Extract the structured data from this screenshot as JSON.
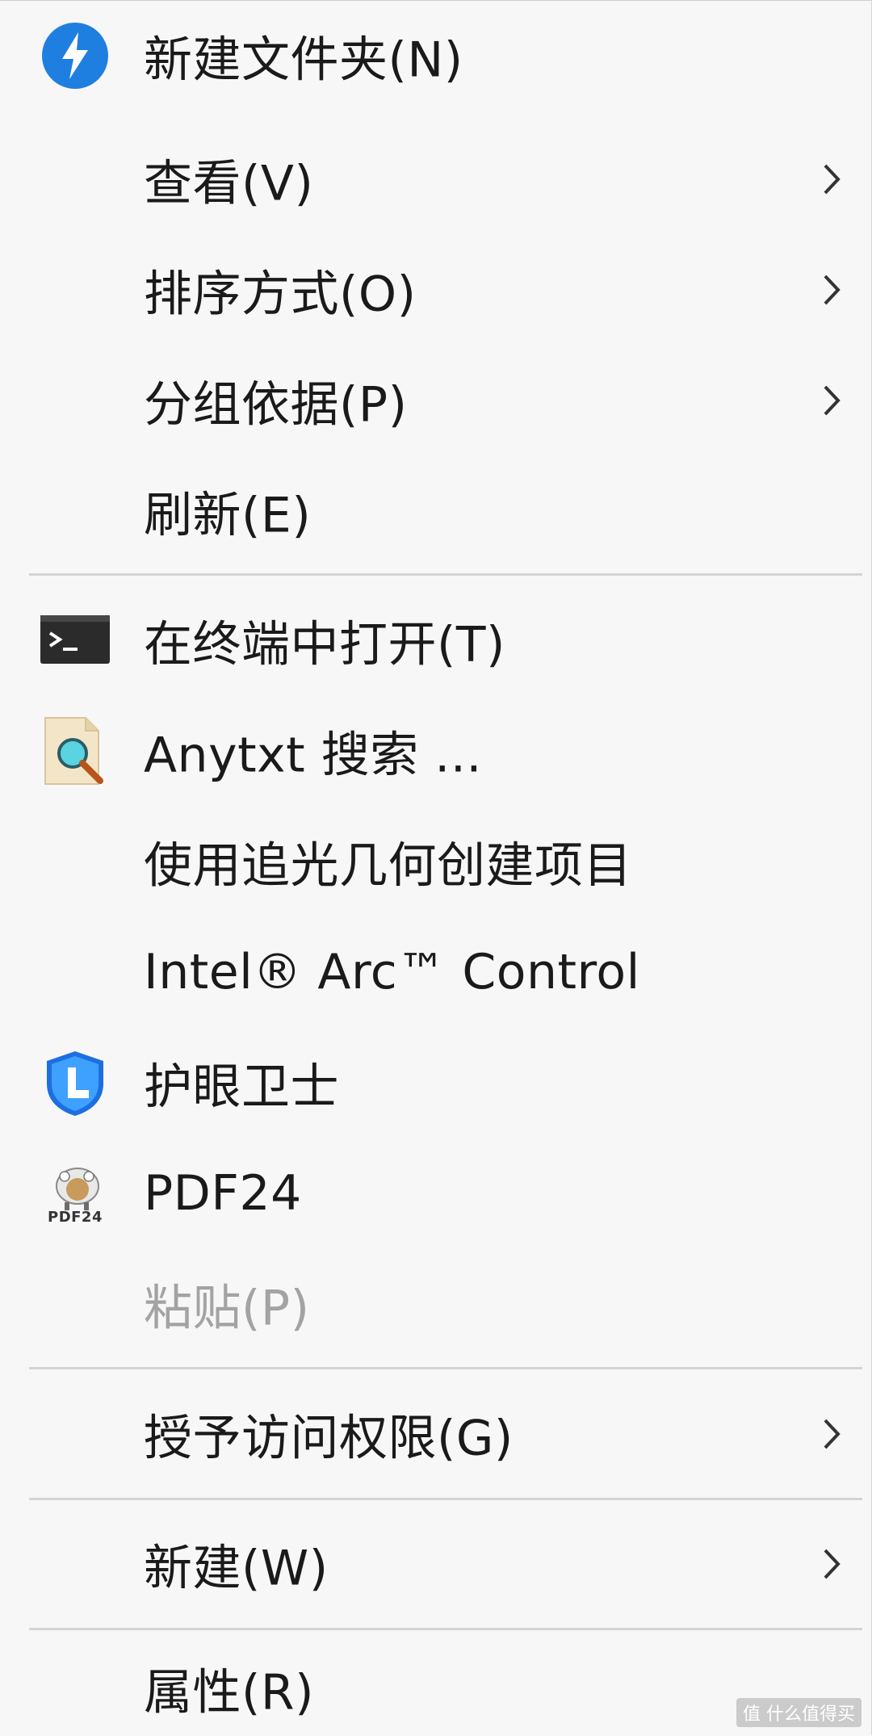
{
  "menu": {
    "items": [
      {
        "label": "新建文件夹(N)",
        "icon": "lightning-circle-icon",
        "submenu": false,
        "disabled": false
      },
      {
        "label": "查看(V)",
        "icon": null,
        "submenu": true,
        "disabled": false
      },
      {
        "label": "排序方式(O)",
        "icon": null,
        "submenu": true,
        "disabled": false
      },
      {
        "label": "分组依据(P)",
        "icon": null,
        "submenu": true,
        "disabled": false
      },
      {
        "label": "刷新(E)",
        "icon": null,
        "submenu": false,
        "disabled": false
      },
      {
        "label": "在终端中打开(T)",
        "icon": "terminal-icon",
        "submenu": false,
        "disabled": false
      },
      {
        "label": "Anytxt 搜索 ...",
        "icon": "anytxt-search-icon",
        "submenu": false,
        "disabled": false
      },
      {
        "label": "使用追光几何创建项目",
        "icon": null,
        "submenu": false,
        "disabled": false
      },
      {
        "label": "Intel® Arc™ Control",
        "icon": null,
        "submenu": false,
        "disabled": false
      },
      {
        "label": "护眼卫士",
        "icon": "eye-guard-shield-icon",
        "submenu": false,
        "disabled": false
      },
      {
        "label": "PDF24",
        "icon": "pdf24-icon",
        "submenu": false,
        "disabled": false
      },
      {
        "label": "粘贴(P)",
        "icon": null,
        "submenu": false,
        "disabled": true
      },
      {
        "label": "授予访问权限(G)",
        "icon": null,
        "submenu": true,
        "disabled": false
      },
      {
        "label": "新建(W)",
        "icon": null,
        "submenu": true,
        "disabled": false
      },
      {
        "label": "属性(R)",
        "icon": null,
        "submenu": false,
        "disabled": false
      }
    ],
    "pdf24_icon_text": "PDF24"
  },
  "watermark": "值 什么值得买",
  "colors": {
    "background": "#f7f7f7",
    "text": "#1a1a1a",
    "disabled_text": "#a3a3a3",
    "separator": "#d4d4d4",
    "accent_blue": "#1f7fe0"
  }
}
